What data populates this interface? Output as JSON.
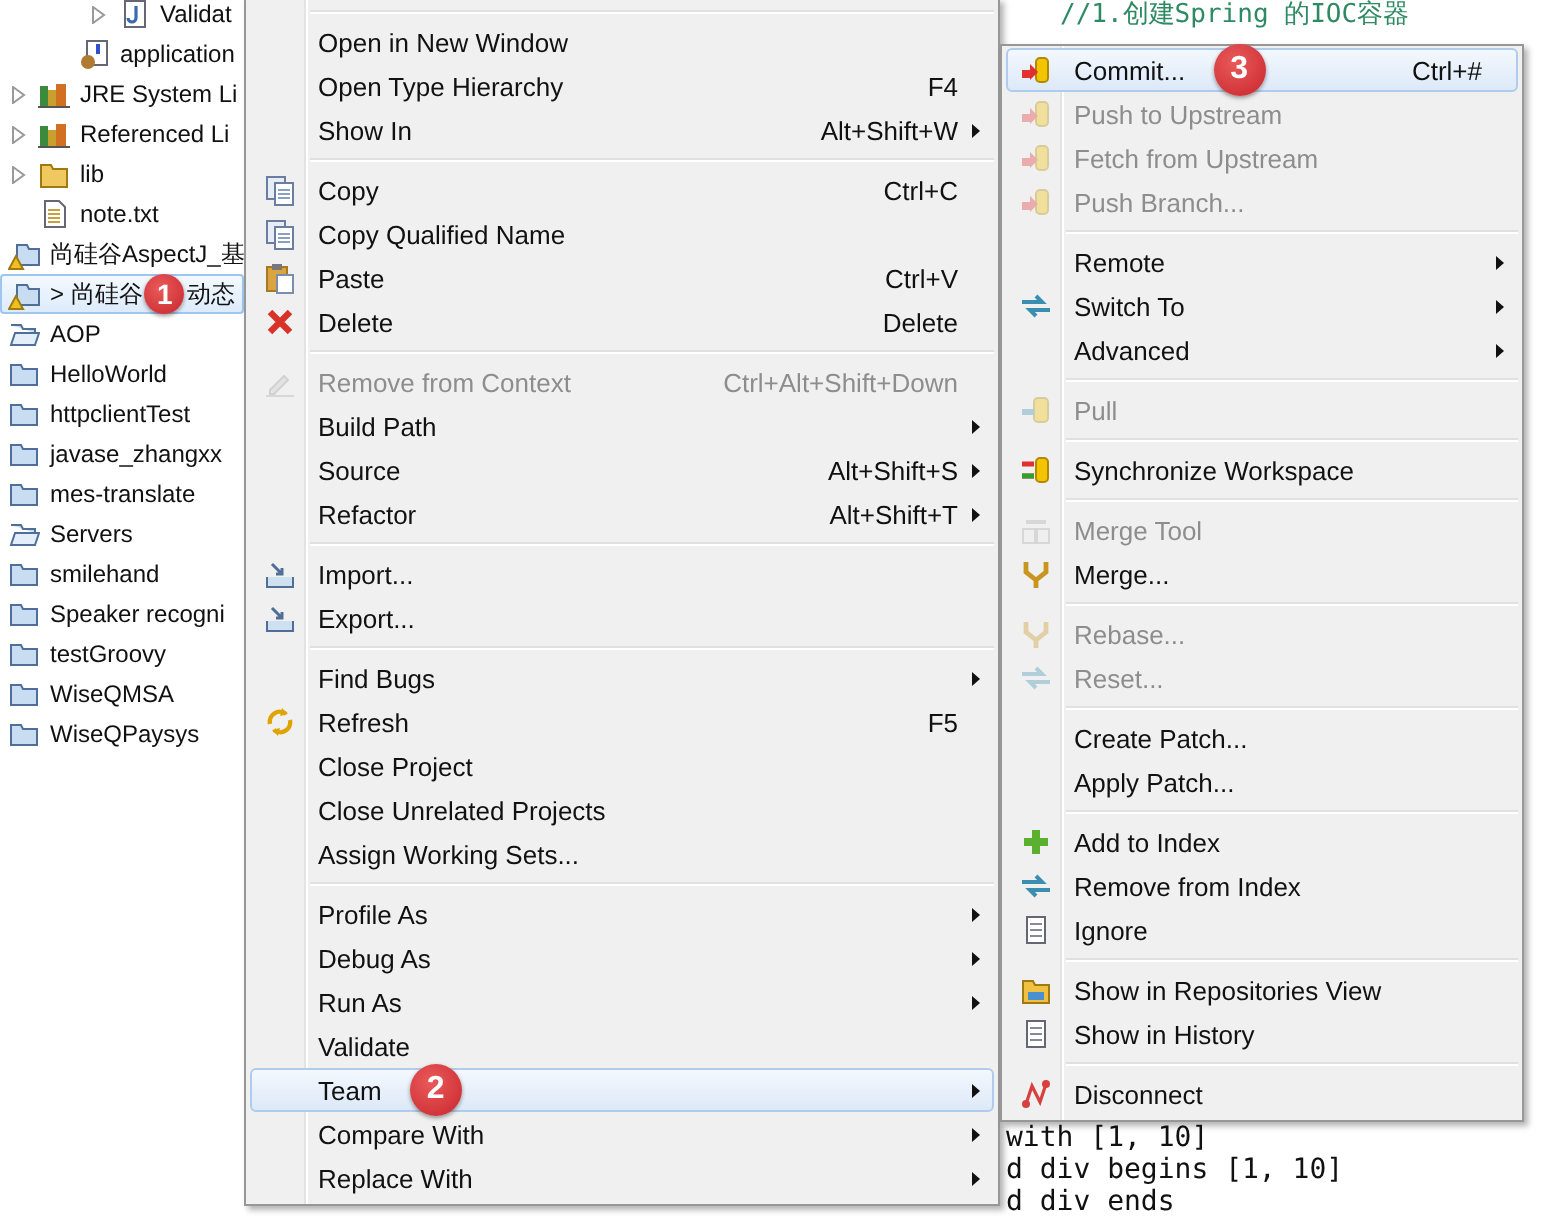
{
  "tree": {
    "items": [
      {
        "children": [
          {
            "children": [
              {
                "children": [
                  {
                    "label": "Validat",
                    "kind": "java-file",
                    "expanded": false,
                    "selected": false
                  }
                ]
              },
              {
                "label": "application",
                "kind": "config-file",
                "selected": false
              }
            ]
          },
          {
            "label": "JRE System Li",
            "kind": "library",
            "expanded": false,
            "selected": false
          },
          {
            "label": "Referenced Li",
            "kind": "library",
            "expanded": false,
            "selected": false
          },
          {
            "label": "lib",
            "kind": "folder",
            "expanded": false,
            "selected": false
          },
          {
            "label": "note.txt",
            "kind": "text-file",
            "selected": false
          }
        ]
      },
      {
        "label": "尚硅谷AspectJ_基",
        "kind": "spring-project",
        "selected": false
      },
      {
        "label": "> 尚硅谷",
        "label_after": "动态",
        "badge": "1",
        "kind": "spring-project",
        "selected": true
      },
      {
        "label": "AOP",
        "kind": "open-project",
        "selected": false
      },
      {
        "label": "HelloWorld",
        "kind": "project",
        "selected": false
      },
      {
        "label": "httpclientTest",
        "kind": "project",
        "selected": false
      },
      {
        "label": "javase_zhangxx",
        "kind": "project",
        "selected": false
      },
      {
        "label": "mes-translate",
        "kind": "project",
        "selected": false
      },
      {
        "label": "Servers",
        "kind": "open-project",
        "selected": false
      },
      {
        "label": "smilehand",
        "kind": "project",
        "selected": false
      },
      {
        "label": "Speaker recogni",
        "kind": "project",
        "selected": false
      },
      {
        "label": "testGroovy",
        "kind": "project",
        "selected": false
      },
      {
        "label": "WiseQMSA",
        "kind": "project",
        "selected": false
      },
      {
        "label": "WiseQPaysys",
        "kind": "project",
        "selected": false
      }
    ]
  },
  "editor": {
    "lines_top": [
      "//1.创建Spring 的IOC容器"
    ],
    "lines_bottom": [
      "with [1, 10]",
      "d div begins [1, 10]",
      "d div ends"
    ]
  },
  "context_menu": {
    "groups": [
      [
        {
          "label": "Open in New Window",
          "disabled": false,
          "submenu": false,
          "selected": false
        },
        {
          "label": "Open Type Hierarchy",
          "shortcut": "F4",
          "disabled": false,
          "submenu": false,
          "selected": false
        },
        {
          "label": "Show In",
          "shortcut": "Alt+Shift+W",
          "disabled": false,
          "submenu": true,
          "selected": false
        }
      ],
      [
        {
          "label": "Copy",
          "shortcut": "Ctrl+C",
          "disabled": false,
          "submenu": false,
          "selected": false
        },
        {
          "label": "Copy Qualified Name",
          "disabled": false,
          "submenu": false,
          "selected": false
        },
        {
          "label": "Paste",
          "shortcut": "Ctrl+V",
          "disabled": false,
          "submenu": false,
          "selected": false
        },
        {
          "label": "Delete",
          "shortcut": "Delete",
          "disabled": false,
          "submenu": false,
          "selected": false
        }
      ],
      [
        {
          "label": "Remove from Context",
          "shortcut": "Ctrl+Alt+Shift+Down",
          "disabled": true,
          "submenu": false,
          "selected": false
        },
        {
          "label": "Build Path",
          "disabled": false,
          "submenu": true,
          "selected": false
        },
        {
          "label": "Source",
          "shortcut": "Alt+Shift+S",
          "disabled": false,
          "submenu": true,
          "selected": false
        },
        {
          "label": "Refactor",
          "shortcut": "Alt+Shift+T",
          "disabled": false,
          "submenu": true,
          "selected": false
        }
      ],
      [
        {
          "label": "Import...",
          "disabled": false,
          "submenu": false,
          "selected": false
        },
        {
          "label": "Export...",
          "disabled": false,
          "submenu": false,
          "selected": false
        }
      ],
      [
        {
          "label": "Find Bugs",
          "disabled": false,
          "submenu": true,
          "selected": false
        },
        {
          "label": "Refresh",
          "shortcut": "F5",
          "disabled": false,
          "submenu": false,
          "selected": false
        },
        {
          "label": "Close Project",
          "disabled": false,
          "submenu": false,
          "selected": false
        },
        {
          "label": "Close Unrelated Projects",
          "disabled": false,
          "submenu": false,
          "selected": false
        },
        {
          "label": "Assign Working Sets...",
          "disabled": false,
          "submenu": false,
          "selected": false
        }
      ],
      [
        {
          "label": "Profile As",
          "disabled": false,
          "submenu": true,
          "selected": false
        },
        {
          "label": "Debug As",
          "disabled": false,
          "submenu": true,
          "selected": false
        },
        {
          "label": "Run As",
          "disabled": false,
          "submenu": true,
          "selected": false
        },
        {
          "label": "Validate",
          "disabled": false,
          "submenu": false,
          "selected": false
        },
        {
          "label": "Team",
          "badge": "2",
          "disabled": false,
          "submenu": true,
          "selected": true
        },
        {
          "label": "Compare With",
          "disabled": false,
          "submenu": true,
          "selected": false
        },
        {
          "label": "Replace With",
          "disabled": false,
          "submenu": true,
          "selected": false
        }
      ]
    ]
  },
  "team_submenu": {
    "groups": [
      [
        {
          "label": "Commit...",
          "badge": "3",
          "shortcut": "Ctrl+#",
          "disabled": false,
          "submenu": false,
          "selected": true
        },
        {
          "label": "Push to Upstream",
          "disabled": true,
          "submenu": false,
          "selected": false
        },
        {
          "label": "Fetch from Upstream",
          "disabled": true,
          "submenu": false,
          "selected": false
        },
        {
          "label": "Push Branch...",
          "disabled": true,
          "submenu": false,
          "selected": false
        }
      ],
      [
        {
          "label": "Remote",
          "disabled": false,
          "submenu": true,
          "selected": false
        },
        {
          "label": "Switch To",
          "disabled": false,
          "submenu": true,
          "selected": false
        },
        {
          "label": "Advanced",
          "disabled": false,
          "submenu": true,
          "selected": false
        }
      ],
      [
        {
          "label": "Pull",
          "disabled": true,
          "submenu": false,
          "selected": false
        }
      ],
      [
        {
          "label": "Synchronize Workspace",
          "disabled": false,
          "submenu": false,
          "selected": false
        }
      ],
      [
        {
          "label": "Merge Tool",
          "disabled": true,
          "submenu": false,
          "selected": false
        },
        {
          "label": "Merge...",
          "disabled": false,
          "submenu": false,
          "selected": false
        }
      ],
      [
        {
          "label": "Rebase...",
          "disabled": true,
          "submenu": false,
          "selected": false
        },
        {
          "label": "Reset...",
          "disabled": true,
          "submenu": false,
          "selected": false
        }
      ],
      [
        {
          "label": "Create Patch...",
          "disabled": false,
          "submenu": false,
          "selected": false
        },
        {
          "label": "Apply Patch...",
          "disabled": false,
          "submenu": false,
          "selected": false
        }
      ],
      [
        {
          "label": "Add to Index",
          "disabled": false,
          "submenu": false,
          "selected": false
        },
        {
          "label": "Remove from Index",
          "disabled": false,
          "submenu": false,
          "selected": false
        },
        {
          "label": "Ignore",
          "disabled": false,
          "submenu": false,
          "selected": false
        }
      ],
      [
        {
          "label": "Show in Repositories View",
          "disabled": false,
          "submenu": false,
          "selected": false
        },
        {
          "label": "Show in History",
          "disabled": false,
          "submenu": false,
          "selected": false
        }
      ],
      [
        {
          "label": "Disconnect",
          "disabled": false,
          "submenu": false,
          "selected": false
        }
      ]
    ]
  }
}
